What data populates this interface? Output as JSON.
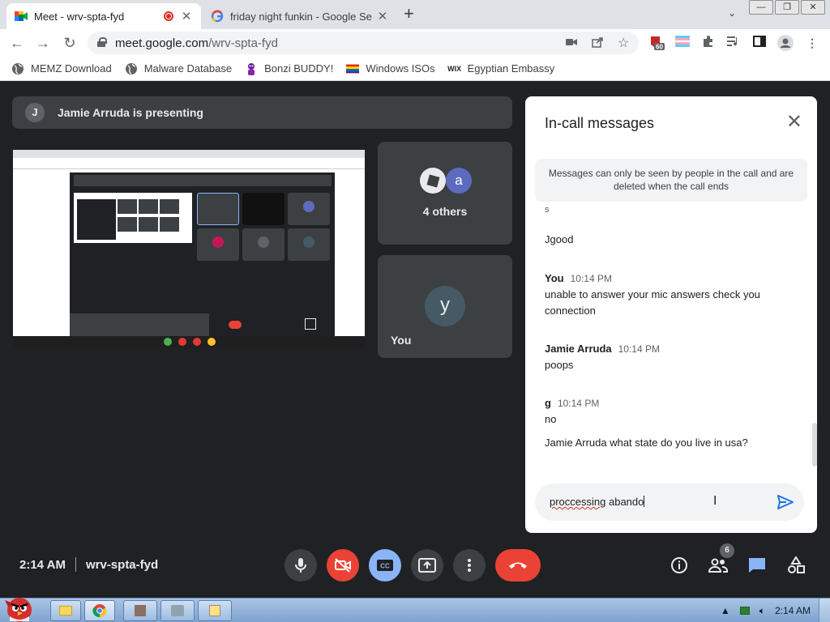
{
  "browser": {
    "tabs": [
      {
        "title": "Meet - wrv-spta-fyd",
        "favicon": "google-meet-icon",
        "recording": true
      },
      {
        "title": "friday night funkin - Google Se",
        "favicon": "google-g-icon"
      }
    ],
    "new_tab": "+",
    "url_host": "meet.google.com",
    "url_path": "/wrv-spta-fyd",
    "extension_badge": "60",
    "window_buttons": {
      "minimize": "—",
      "maximize": "❐",
      "close": "✕"
    }
  },
  "bookmarks": [
    {
      "label": "MEMZ Download",
      "icon": "globe-icon"
    },
    {
      "label": "Malware Database",
      "icon": "globe-icon"
    },
    {
      "label": "Bonzi BUDDY!",
      "icon": "bonzi-icon"
    },
    {
      "label": "Windows ISOs",
      "icon": "rainbow-flag-icon"
    },
    {
      "label": "Egyptian Embassy",
      "icon": "wix-icon",
      "icon_text": "WIX"
    }
  ],
  "meet": {
    "presenter_initial": "J",
    "presenting_text": "Jamie Arruda is presenting",
    "others_avatar": "a",
    "others_label": "4 others",
    "you_initial": "y",
    "you_label": "You",
    "time": "2:14 AM",
    "meeting_code": "wrv-spta-fyd",
    "participants_count": "6"
  },
  "chat": {
    "title": "In-call messages",
    "notice": "Messages can only be seen by people in the call and are deleted when the call ends",
    "fragment": "s",
    "messages": [
      {
        "text": "Jgood"
      },
      {
        "sender": "You",
        "time": "10:14 PM",
        "text": "unable to answer your mic answers check you connection"
      },
      {
        "sender": "Jamie Arruda",
        "time": "10:14 PM",
        "text": "poops"
      },
      {
        "sender": "g",
        "time": "10:14 PM",
        "text": "no"
      },
      {
        "text": "Jamie Arruda what state do you live in usa?"
      }
    ],
    "draft_word1": "proccessing",
    "draft_word2": " abando"
  },
  "taskbar": {
    "clock": "2:14 AM",
    "tray_icons": [
      "up-arrow-icon",
      "battery-icon",
      "speaker-icon"
    ]
  },
  "colors": {
    "meet_bg": "#202124",
    "tile_bg": "#3c4043",
    "end_call": "#ea4335",
    "captions_active": "#8ab4f8",
    "chat_active": "#8ab4f8"
  }
}
